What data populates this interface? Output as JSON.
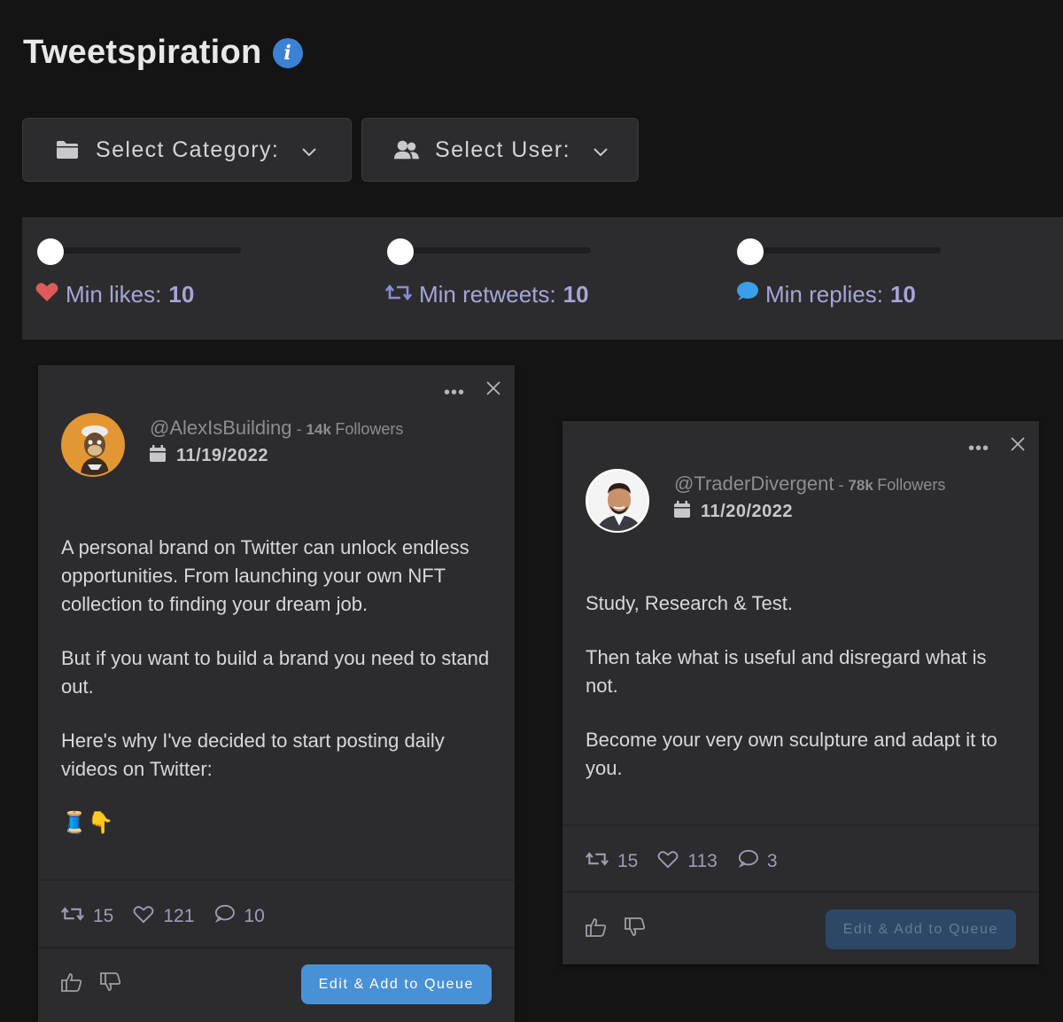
{
  "app": {
    "title": "Tweetspiration"
  },
  "dropdowns": {
    "category": {
      "label": "Select Category:"
    },
    "user": {
      "label": "Select User:"
    }
  },
  "filters": {
    "likes": {
      "label": "Min likes:",
      "value": "10",
      "slider_fraction": 0
    },
    "retweets": {
      "label": "Min retweets:",
      "value": "10",
      "slider_fraction": 0
    },
    "replies": {
      "label": "Min replies:",
      "value": "10",
      "slider_fraction": 0
    }
  },
  "tweets": [
    {
      "handle": "@AlexIsBuilding",
      "separator": " - ",
      "followers_count": "14k",
      "followers_word": "Followers",
      "date": "11/19/2022",
      "paragraphs": [
        "A personal brand on Twitter can unlock endless opportunities. From launching your own NFT collection to finding your dream job.",
        "But if you want to build a brand you need to stand out.",
        "Here's why I've decided to start posting daily videos on Twitter:"
      ],
      "emojis": "🧵👇",
      "retweets": "15",
      "likes": "121",
      "replies": "10",
      "button_label": "Edit & Add to Queue"
    },
    {
      "handle": "@TraderDivergent",
      "separator": " - ",
      "followers_count": "78k",
      "followers_word": "Followers",
      "date": "11/20/2022",
      "paragraphs": [
        "Study, Research & Test.",
        "Then take what is useful and disregard what is not.",
        "Become your very own sculpture and adapt it to you."
      ],
      "retweets": "15",
      "likes": "113",
      "replies": "3",
      "button_label": "Edit & Add to Queue"
    }
  ],
  "colors": {
    "background": "#141415",
    "panel": "#2c2c2e",
    "accent": "#4891d6",
    "info": "#3b82d6",
    "heart": "#e05a5a",
    "label": "#a5a5d8"
  }
}
